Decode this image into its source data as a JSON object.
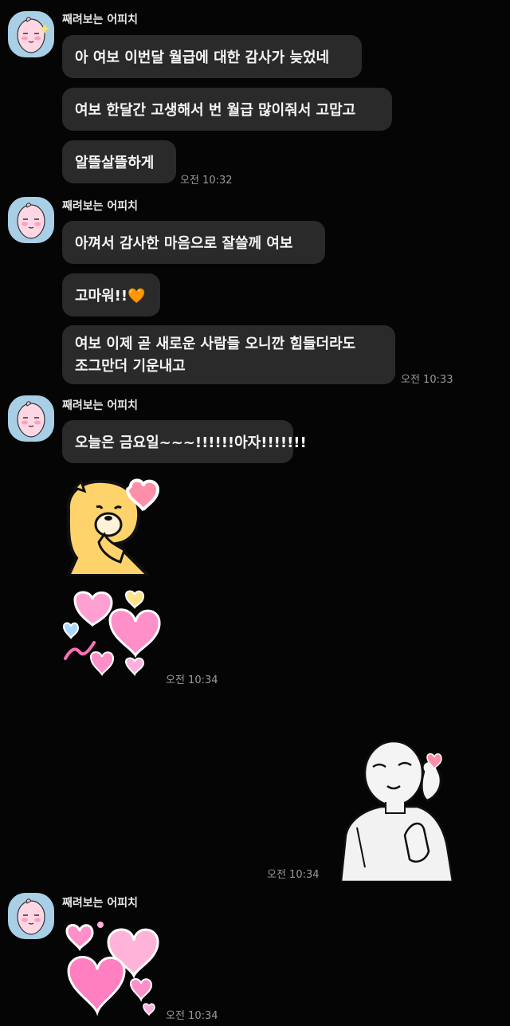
{
  "colors": {
    "background": "#050505",
    "bubble": "#2a2a2a",
    "text": "#f5f5f5",
    "timestamp": "#9a9a9a",
    "avatar_bg": "#a8cfe6",
    "heart_pink": "#ff8fc8"
  },
  "groups": [
    {
      "sender": "째려보는 어피치",
      "messages": [
        "아 여보 이번달 월급에 대한 감사가 늦었네",
        "여보 한달간 고생해서 번 월급 많이줘서 고맙고",
        "알뜰살뜰하게"
      ],
      "time": "오전 10:32"
    },
    {
      "sender": "째려보는 어피치",
      "messages": [
        "아껴서 감사한 마음으로 잘쓸께 여보",
        "고마워!!🧡",
        "여보 이제 곧 새로운 사람들 오니깐 힘들더라도\n조그만더 기운내고"
      ],
      "time": "오전 10:33"
    },
    {
      "sender": "째려보는 어피치",
      "messages": [
        "오늘은 금요일~~~!!!!!!아자!!!!!!!"
      ],
      "stickers": [
        "choonsik-heart-sticker",
        "pink-hearts-sticker"
      ],
      "time": "오전 10:34"
    },
    {
      "sender": "",
      "stickers": [
        "blowing-kiss-man-sticker"
      ],
      "time": "오전 10:34"
    },
    {
      "sender": "째려보는 어피치",
      "stickers": [
        "peach-hearts-sticker"
      ],
      "time": "오전 10:34"
    }
  ]
}
